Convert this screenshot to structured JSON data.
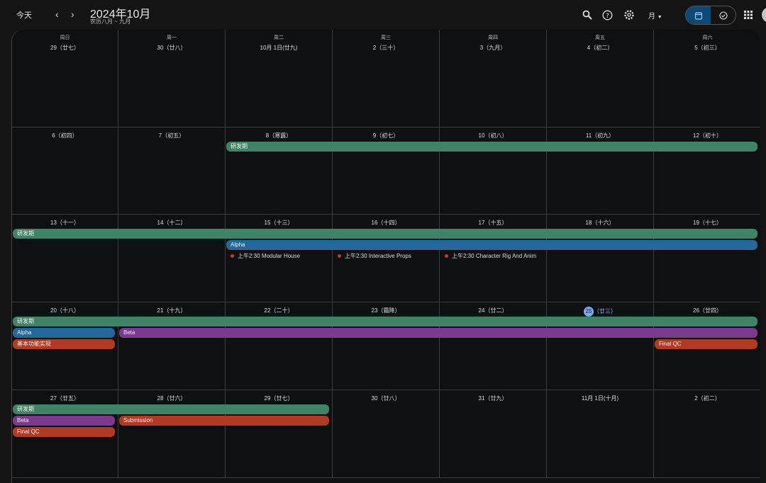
{
  "header": {
    "today_label": "今天",
    "prev": "‹",
    "next": "›",
    "title": "2024年10月",
    "subtitle": "农历八月 ~ 九月",
    "view_label": "月",
    "icons": [
      "search-icon",
      "help-icon",
      "settings-icon",
      "calendar-icon",
      "tasks-icon",
      "apps-icon",
      "avatar"
    ]
  },
  "calendar": {
    "weekdays": [
      "周日",
      "周一",
      "周二",
      "周三",
      "周四",
      "周五",
      "周六"
    ],
    "first_date": "2024-09-29",
    "today": "2024-10-25",
    "days": [
      [
        "29（廿七）",
        "30（廿八）",
        "10月 1日(廿九)",
        "2（三十）",
        "3（九月）",
        "4（初二）",
        "5（初三）"
      ],
      [
        "6（初四）",
        "7（初五）",
        "8（寒露）",
        "9（初七）",
        "10（初八）",
        "11（初九）",
        "12（初十）"
      ],
      [
        "13（十一）",
        "14（十二）",
        "15（十三）",
        "16（十四）",
        "17（十五）",
        "18（十六）",
        "19（十七）"
      ],
      [
        "20（十八）",
        "21（十九）",
        "22（二十）",
        "23（霜降）",
        "24（廿二）",
        "25",
        "26（廿四）"
      ],
      [
        "27（廿五）",
        "28（廿六）",
        "29（廿七）",
        "30（廿八）",
        "31（廿九）",
        "11月 1日(十月)",
        "2（初二）"
      ]
    ],
    "today_lunar": "（廿三）",
    "events": [
      {
        "title": "研发期",
        "start": "2024-10-08",
        "end": "2024-10-29",
        "color": "#3f8466"
      },
      {
        "title": "Alpha",
        "start": "2024-10-15",
        "end": "2024-10-20",
        "color": "#24679c"
      },
      {
        "title": "Beta",
        "start": "2024-10-21",
        "end": "2024-10-27",
        "color": "#7a3b8f"
      },
      {
        "title": "Submission",
        "start": "2024-10-28",
        "end": "2024-10-29",
        "color": "#b13a22"
      },
      {
        "title": "基本功能实现",
        "start": "2024-10-20",
        "end": "2024-10-20",
        "color": "#b13a22"
      },
      {
        "title": "Final QC",
        "start": "2024-10-26",
        "end": "2024-10-27",
        "color": "#b13a22"
      }
    ],
    "timed_events": [
      {
        "time": "上午2:30",
        "title": "Modular House",
        "date": "2024-10-15",
        "color": "#c0392b"
      },
      {
        "time": "上午2:30",
        "title": "Interactive Props",
        "date": "2024-10-16",
        "color": "#c0392b"
      },
      {
        "time": "上午2:30",
        "title": "Character Rig And Anim",
        "date": "2024-10-17",
        "color": "#c0392b"
      }
    ]
  }
}
